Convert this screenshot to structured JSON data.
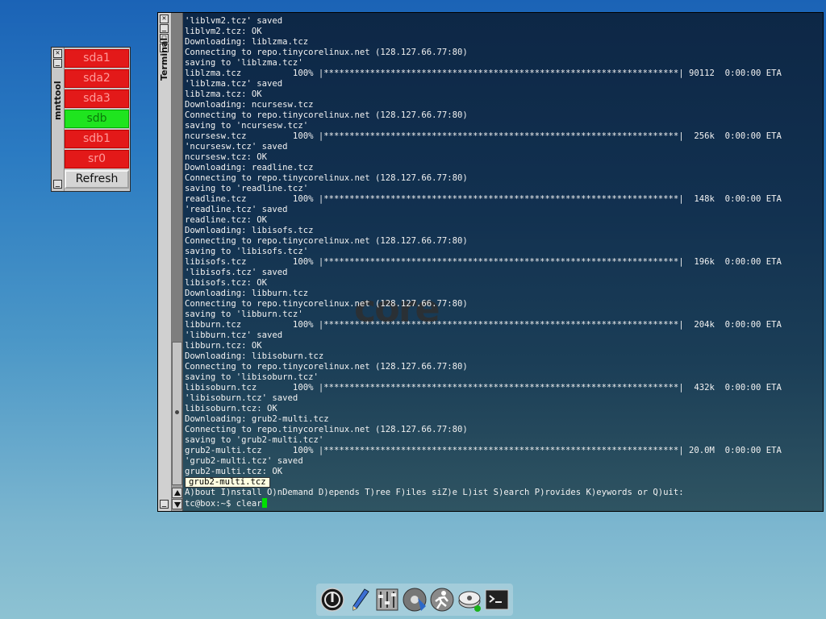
{
  "mnttool": {
    "title": "mnttool",
    "buttons": [
      {
        "label": "sda1",
        "state": "unmounted"
      },
      {
        "label": "sda2",
        "state": "unmounted"
      },
      {
        "label": "sda3",
        "state": "unmounted"
      },
      {
        "label": "sdb",
        "state": "mounted"
      },
      {
        "label": "sdb1",
        "state": "unmounted"
      },
      {
        "label": "sr0",
        "state": "unmounted"
      }
    ],
    "refresh_label": "Refresh"
  },
  "terminal": {
    "title": "Terminal",
    "lines": [
      "'liblvm2.tcz' saved",
      "liblvm2.tcz: OK",
      "Downloading: liblzma.tcz",
      "Connecting to repo.tinycorelinux.net (128.127.66.77:80)",
      "saving to 'liblzma.tcz'",
      "liblzma.tcz          100% |*********************************************************************| 90112  0:00:00 ETA",
      "'liblzma.tcz' saved",
      "liblzma.tcz: OK",
      "Downloading: ncursesw.tcz",
      "Connecting to repo.tinycorelinux.net (128.127.66.77:80)",
      "saving to 'ncursesw.tcz'",
      "ncursesw.tcz         100% |*********************************************************************|  256k  0:00:00 ETA",
      "'ncursesw.tcz' saved",
      "ncursesw.tcz: OK",
      "Downloading: readline.tcz",
      "Connecting to repo.tinycorelinux.net (128.127.66.77:80)",
      "saving to 'readline.tcz'",
      "readline.tcz         100% |*********************************************************************|  148k  0:00:00 ETA",
      "'readline.tcz' saved",
      "readline.tcz: OK",
      "Downloading: libisofs.tcz",
      "Connecting to repo.tinycorelinux.net (128.127.66.77:80)",
      "saving to 'libisofs.tcz'",
      "libisofs.tcz         100% |*********************************************************************|  196k  0:00:00 ETA",
      "'libisofs.tcz' saved",
      "libisofs.tcz: OK",
      "Downloading: libburn.tcz",
      "Connecting to repo.tinycorelinux.net (128.127.66.77:80)",
      "saving to 'libburn.tcz'",
      "libburn.tcz          100% |*********************************************************************|  204k  0:00:00 ETA",
      "'libburn.tcz' saved",
      "libburn.tcz: OK",
      "Downloading: libisoburn.tcz",
      "Connecting to repo.tinycorelinux.net (128.127.66.77:80)",
      "saving to 'libisoburn.tcz'",
      "libisoburn.tcz       100% |*********************************************************************|  432k  0:00:00 ETA",
      "'libisoburn.tcz' saved",
      "libisoburn.tcz: OK",
      "Downloading: grub2-multi.tcz",
      "Connecting to repo.tinycorelinux.net (128.127.66.77:80)",
      "saving to 'grub2-multi.tcz'",
      "grub2-multi.tcz      100% |*********************************************************************| 20.0M  0:00:00 ETA",
      "'grub2-multi.tcz' saved",
      "grub2-multi.tcz: OK"
    ],
    "tooltip": "grub2-multi.tcz",
    "menu_line": "A)bout I)nstall O)nDemand D)epends T)ree F)iles siZ)e L)ist S)earch P)rovides K)eywords or Q)uit:",
    "prompt": "tc@box:~$ ",
    "command": "clear",
    "background_logo": "core"
  },
  "dock": {
    "icons": [
      "power-icon",
      "editor-pen-icon",
      "control-panel-icon",
      "apps-install-icon",
      "run-icon",
      "mount-tool-icon",
      "terminal-icon"
    ]
  }
}
